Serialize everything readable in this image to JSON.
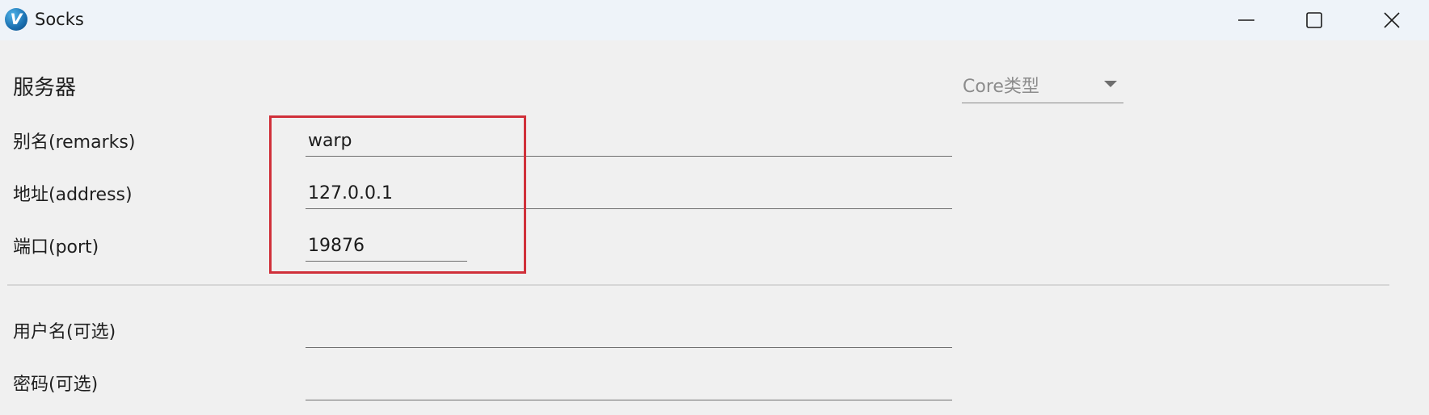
{
  "window": {
    "title": "Socks",
    "app_icon_letter": "V"
  },
  "section": {
    "title": "服务器"
  },
  "core_type": {
    "label": "Core类型",
    "icon": "triangle-down-icon"
  },
  "fields": {
    "remarks": {
      "label": "别名(remarks)",
      "value": "warp"
    },
    "address": {
      "label": "地址(address)",
      "value": "127.0.0.1"
    },
    "port": {
      "label": "端口(port)",
      "value": "19876"
    },
    "username": {
      "label": "用户名(可选)",
      "value": ""
    },
    "password": {
      "label": "密码(可选)",
      "value": ""
    }
  },
  "colors": {
    "highlight_border": "#d0303a",
    "titlebar_bg": "#eef3f9",
    "window_bg": "#f0f0f0"
  }
}
